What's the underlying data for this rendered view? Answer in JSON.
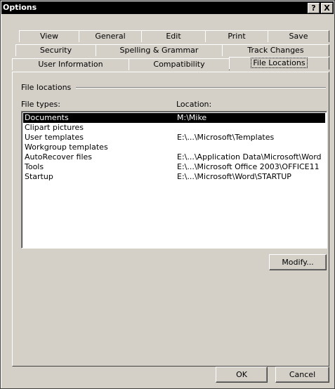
{
  "window": {
    "title": "Options",
    "help_label": "?",
    "close_label": "X"
  },
  "tabs": {
    "row1": [
      "View",
      "General",
      "Edit",
      "Print",
      "Save"
    ],
    "row2": [
      "Security",
      "Spelling & Grammar",
      "Track Changes"
    ],
    "row3": [
      "User Information",
      "Compatibility",
      "File Locations"
    ]
  },
  "group": {
    "label": "File locations"
  },
  "list": {
    "col_file_types": "File types:",
    "col_location": "Location:",
    "rows": [
      {
        "type": "Documents",
        "location": "M:\\Mike"
      },
      {
        "type": "Clipart pictures",
        "location": ""
      },
      {
        "type": "User templates",
        "location": "E:\\...\\Microsoft\\Templates"
      },
      {
        "type": "Workgroup templates",
        "location": ""
      },
      {
        "type": "AutoRecover files",
        "location": "E:\\...\\Application Data\\Microsoft\\Word"
      },
      {
        "type": "Tools",
        "location": "E:\\...\\Microsoft Office 2003\\OFFICE11"
      },
      {
        "type": "Startup",
        "location": "E:\\...\\Microsoft\\Word\\STARTUP"
      }
    ],
    "selected_index": 0
  },
  "buttons": {
    "modify": "Modify...",
    "ok": "OK",
    "cancel": "Cancel"
  }
}
